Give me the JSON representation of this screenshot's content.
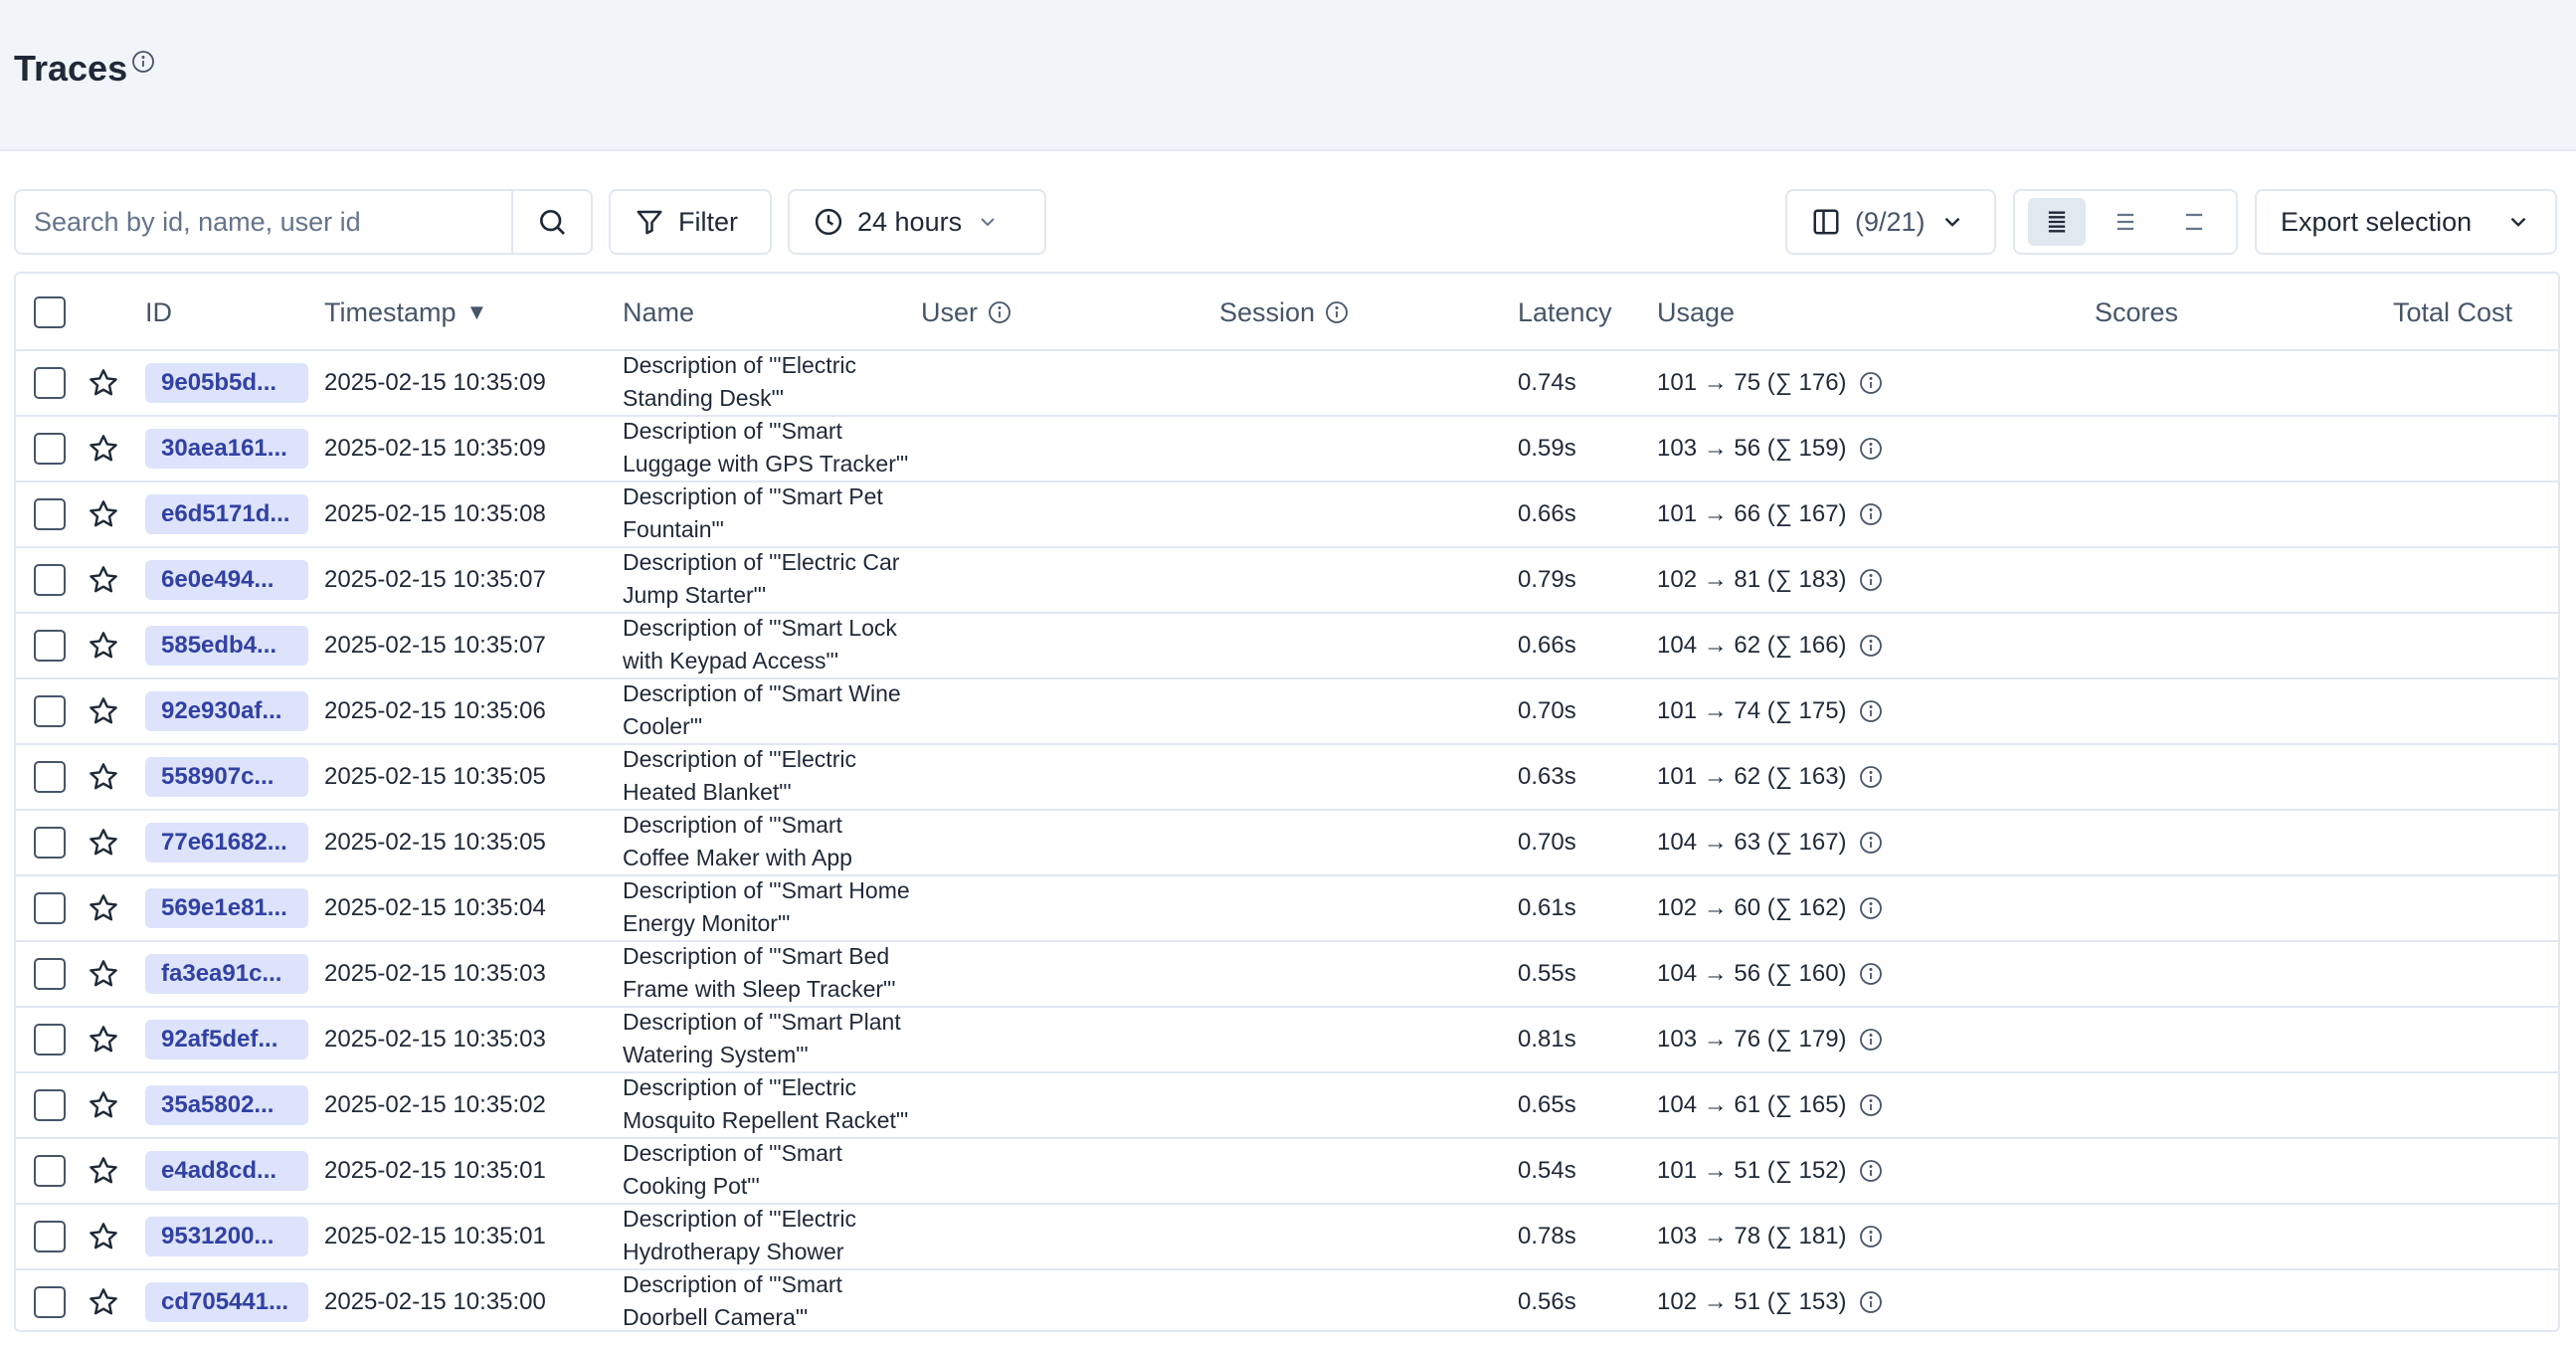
{
  "header": {
    "title": "Traces"
  },
  "toolbar": {
    "search_placeholder": "Search by id, name, user id",
    "filter_label": "Filter",
    "time_range_label": "24 hours",
    "columns_label": "(9/21)",
    "export_label": "Export selection"
  },
  "table": {
    "columns": {
      "id": "ID",
      "timestamp": "Timestamp",
      "sort_indicator": "▼",
      "name": "Name",
      "user": "User",
      "session": "Session",
      "latency": "Latency",
      "usage": "Usage",
      "scores": "Scores",
      "total_cost": "Total Cost"
    },
    "rows": [
      {
        "id": "9e05b5d...",
        "timestamp": "2025-02-15 10:35:09",
        "name": "Description of '\"Electric Standing Desk\"'",
        "latency": "0.74s",
        "usage": "101 → 75 (∑ 176)"
      },
      {
        "id": "30aea161...",
        "timestamp": "2025-02-15 10:35:09",
        "name": "Description of '\"Smart Luggage with GPS Tracker\"'",
        "latency": "0.59s",
        "usage": "103 → 56 (∑ 159)"
      },
      {
        "id": "e6d5171d...",
        "timestamp": "2025-02-15 10:35:08",
        "name": "Description of '\"Smart Pet Fountain\"'",
        "latency": "0.66s",
        "usage": "101 → 66 (∑ 167)"
      },
      {
        "id": "6e0e494...",
        "timestamp": "2025-02-15 10:35:07",
        "name": "Description of '\"Electric Car Jump Starter\"'",
        "latency": "0.79s",
        "usage": "102 → 81 (∑ 183)"
      },
      {
        "id": "585edb4...",
        "timestamp": "2025-02-15 10:35:07",
        "name": "Description of '\"Smart Lock with Keypad Access\"'",
        "latency": "0.66s",
        "usage": "104 → 62 (∑ 166)"
      },
      {
        "id": "92e930af...",
        "timestamp": "2025-02-15 10:35:06",
        "name": "Description of '\"Smart Wine Cooler\"'",
        "latency": "0.70s",
        "usage": "101 → 74 (∑ 175)"
      },
      {
        "id": "558907c...",
        "timestamp": "2025-02-15 10:35:05",
        "name": "Description of '\"Electric Heated Blanket\"'",
        "latency": "0.63s",
        "usage": "101 → 62 (∑ 163)"
      },
      {
        "id": "77e61682...",
        "timestamp": "2025-02-15 10:35:05",
        "name": "Description of '\"Smart Coffee Maker with App Control\"'",
        "latency": "0.70s",
        "usage": "104 → 63 (∑ 167)"
      },
      {
        "id": "569e1e81...",
        "timestamp": "2025-02-15 10:35:04",
        "name": "Description of '\"Smart Home Energy Monitor\"'",
        "latency": "0.61s",
        "usage": "102 → 60 (∑ 162)"
      },
      {
        "id": "fa3ea91c...",
        "timestamp": "2025-02-15 10:35:03",
        "name": "Description of '\"Smart Bed Frame with Sleep Tracker\"'",
        "latency": "0.55s",
        "usage": "104 → 56 (∑ 160)"
      },
      {
        "id": "92af5def...",
        "timestamp": "2025-02-15 10:35:03",
        "name": "Description of '\"Smart Plant Watering System\"'",
        "latency": "0.81s",
        "usage": "103 → 76 (∑ 179)"
      },
      {
        "id": "35a5802...",
        "timestamp": "2025-02-15 10:35:02",
        "name": "Description of '\"Electric Mosquito Repellent Racket\"'",
        "latency": "0.65s",
        "usage": "104 → 61 (∑ 165)"
      },
      {
        "id": "e4ad8cd...",
        "timestamp": "2025-02-15 10:35:01",
        "name": "Description of '\"Smart Cooking Pot\"'",
        "latency": "0.54s",
        "usage": "101 → 51 (∑ 152)"
      },
      {
        "id": "9531200...",
        "timestamp": "2025-02-15 10:35:01",
        "name": "Description of '\"Electric Hydrotherapy Shower Head\"'",
        "latency": "0.78s",
        "usage": "103 → 78 (∑ 181)"
      },
      {
        "id": "cd705441...",
        "timestamp": "2025-02-15 10:35:00",
        "name": "Description of '\"Smart Doorbell Camera\"'",
        "latency": "0.56s",
        "usage": "102 → 51 (∑ 153)"
      }
    ]
  },
  "colors": {
    "header_bg": "#f1f5f9",
    "id_badge_bg": "#dde3fb",
    "id_badge_text": "#3141a3",
    "border": "#e2e8f0"
  }
}
